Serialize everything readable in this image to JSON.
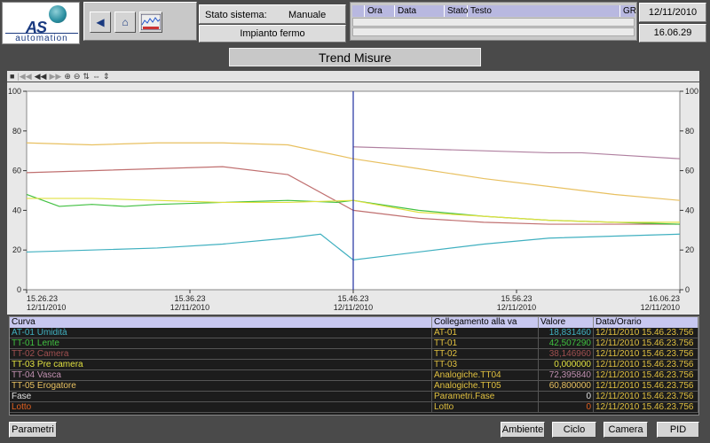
{
  "logo": {
    "brand": "AS",
    "subtitle": "automation"
  },
  "status": {
    "label": "Stato sistema:",
    "mode": "Manuale",
    "plant": "Impianto fermo"
  },
  "alarms": {
    "columns": [
      "Ora",
      "Data",
      "Stato",
      "Testo",
      "GR"
    ]
  },
  "datetime": {
    "date": "12/11/2010",
    "time": "16.06.29"
  },
  "page_title": "Trend Misure",
  "toolbar_icons": [
    "stop-icon",
    "first-icon",
    "rewind-icon",
    "forward-icon",
    "zoom-in-icon",
    "zoom-out-icon",
    "pan-icon",
    "cursor-icon",
    "ruler-icon"
  ],
  "chart_data": {
    "type": "line",
    "y_ticks": [
      "100",
      "80",
      "60",
      "40",
      "20",
      "0"
    ],
    "ylim": [
      0,
      100
    ],
    "x_ticks": [
      {
        "time": "15.26.23",
        "date": "12/11/2010"
      },
      {
        "time": "15.36.23",
        "date": "12/11/2010"
      },
      {
        "time": "15.46.23",
        "date": "12/11/2010"
      },
      {
        "time": "15.56.23",
        "date": "12/11/2010"
      },
      {
        "time": "16.06.23",
        "date": "12/11/2010"
      }
    ],
    "x_minutes": [
      0,
      40
    ],
    "cursor_minute": 20,
    "series": [
      {
        "name": "TT-05 Erogatore",
        "color": "#e8c060",
        "x": [
          0,
          4,
          8,
          12,
          16,
          20,
          24,
          28,
          32,
          36,
          40
        ],
        "values": [
          74,
          73,
          74,
          74,
          73,
          66,
          61,
          56,
          52,
          48,
          45
        ]
      },
      {
        "name": "TT-02 Camera",
        "color": "#c07070",
        "x": [
          0,
          4,
          8,
          12,
          16,
          20,
          24,
          28,
          32,
          36,
          40
        ],
        "values": [
          59,
          60,
          61,
          62,
          58,
          40,
          36,
          34,
          33,
          33,
          33
        ]
      },
      {
        "name": "TT-04 Vasca",
        "color": "#b080a0",
        "x": [
          20,
          24,
          28,
          32,
          34,
          36,
          40
        ],
        "values": [
          72,
          71,
          70,
          69,
          69,
          68,
          66
        ]
      },
      {
        "name": "TT-01 Lente",
        "color": "#40c040",
        "x": [
          0,
          2,
          4,
          6,
          8,
          12,
          16,
          19,
          20,
          24,
          28,
          32,
          36,
          40
        ],
        "values": [
          48,
          42,
          43,
          42,
          43,
          44,
          45,
          44,
          45,
          40,
          37,
          35,
          34,
          33
        ]
      },
      {
        "name": "TT-03 Pre camera",
        "color": "#e0e040",
        "x": [
          0,
          4,
          8,
          12,
          16,
          20,
          24,
          28,
          32,
          36,
          40
        ],
        "values": [
          46,
          46,
          45,
          44,
          44,
          45,
          39,
          37,
          35,
          34,
          34
        ]
      },
      {
        "name": "AT-01 Umidità",
        "color": "#40b0c0",
        "x": [
          0,
          4,
          8,
          12,
          16,
          18,
          20,
          24,
          28,
          32,
          36,
          40
        ],
        "values": [
          19,
          20,
          21,
          23,
          26,
          28,
          15,
          19,
          23,
          26,
          27,
          28
        ]
      }
    ]
  },
  "table": {
    "headers": [
      "Curva",
      "Collegamento alla va",
      "Valore",
      "Data/Orario"
    ],
    "rows": [
      {
        "curva": "AT-01 Umidità",
        "link": "AT-01",
        "value": "18,831460",
        "datetime": "12/11/2010 15.46.23.756",
        "color": "#40b0c0"
      },
      {
        "curva": "TT-01 Lente",
        "link": "TT-01",
        "value": "42,507290",
        "datetime": "12/11/2010 15.46.23.756",
        "color": "#40c040"
      },
      {
        "curva": "TT-02 Camera",
        "link": "TT-02",
        "value": "38,146960",
        "datetime": "12/11/2010 15.46.23.756",
        "color": "#a05050"
      },
      {
        "curva": "TT-03 Pre camera",
        "link": "TT-03",
        "value": "0,000000",
        "datetime": "12/11/2010 15.46.23.756",
        "color": "#e0e040"
      },
      {
        "curva": "TT-04 Vasca",
        "link": "Analogiche.TT04",
        "value": "72,395840",
        "datetime": "12/11/2010 15.46.23.756",
        "color": "#c090b0"
      },
      {
        "curva": "TT-05 Erogatore",
        "link": "Analogiche.TT05",
        "value": "60,800000",
        "datetime": "12/11/2010 15.46.23.756",
        "color": "#e8c060"
      },
      {
        "curva": "Fase",
        "link": "Parametri.Fase",
        "value": "0",
        "datetime": "12/11/2010 15.46.23.756",
        "color": "#e0e0e0"
      },
      {
        "curva": "Lotto",
        "link": "Lotto",
        "value": "0",
        "datetime": "12/11/2010 15.46.23.756",
        "color": "#e06020"
      }
    ]
  },
  "buttons": {
    "parametri": "Parametri",
    "ambiente": "Ambiente",
    "ciclo": "Ciclo",
    "camera": "Camera",
    "pid": "PID"
  }
}
